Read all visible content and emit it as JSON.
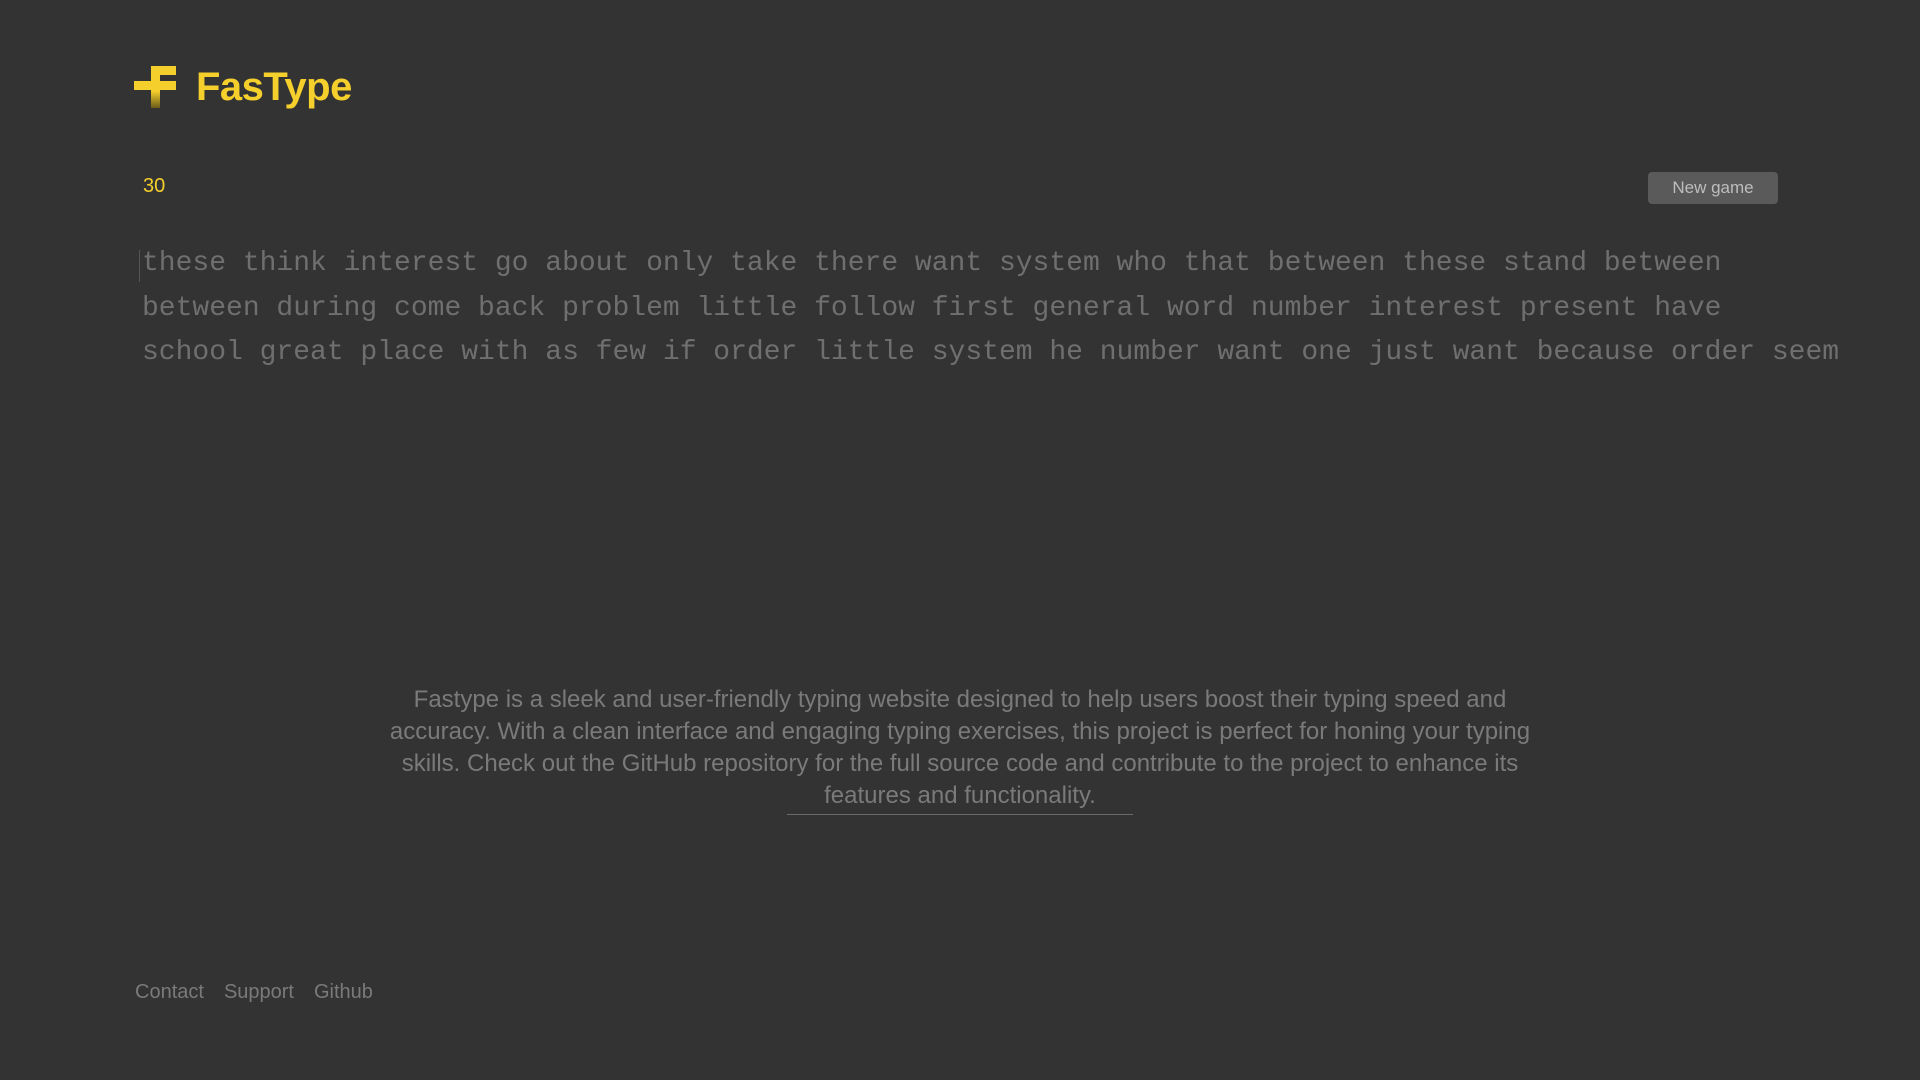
{
  "header": {
    "logo_icon": "cross-logo-icon",
    "title": "FasType"
  },
  "game": {
    "timer": "30",
    "new_game_label": "New game",
    "lines": [
      "these think interest go about only take there want system who that between these stand between",
      "between during come back problem little follow first general word number interest present have",
      "school great place with as few if order little system he number want one just want because order seem"
    ]
  },
  "about": {
    "text": "Fastype is a sleek and user-friendly typing website designed to help users boost their typing speed and accuracy. With a clean interface and engaging typing exercises, this project is perfect for honing your typing skills. Check out the GitHub repository for the full source code and contribute to the project to enhance its features and functionality."
  },
  "footer": {
    "links": [
      "Contact",
      "Support",
      "Github"
    ]
  },
  "colors": {
    "background": "#333333",
    "accent": "#f5cf2c",
    "muted_text": "#6f6f6f"
  }
}
